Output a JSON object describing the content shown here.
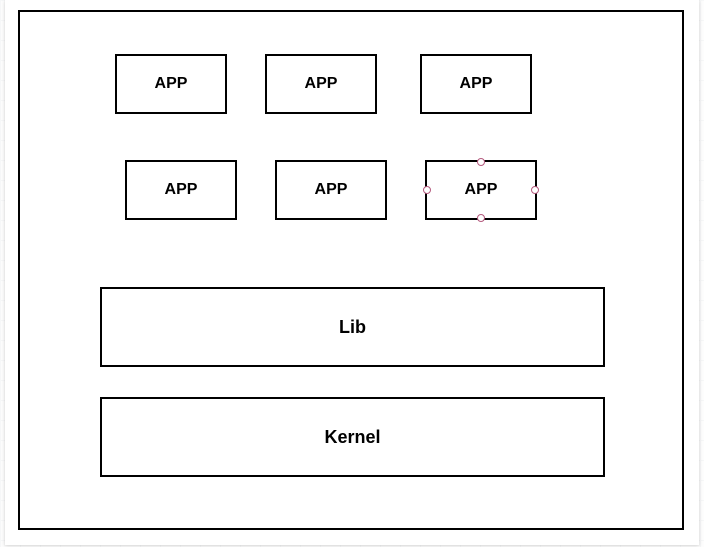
{
  "diagram": {
    "apps": [
      "APP",
      "APP",
      "APP",
      "APP",
      "APP",
      "APP"
    ],
    "lib_label": "Lib",
    "kernel_label": "Kernel",
    "selected_index": 5
  }
}
